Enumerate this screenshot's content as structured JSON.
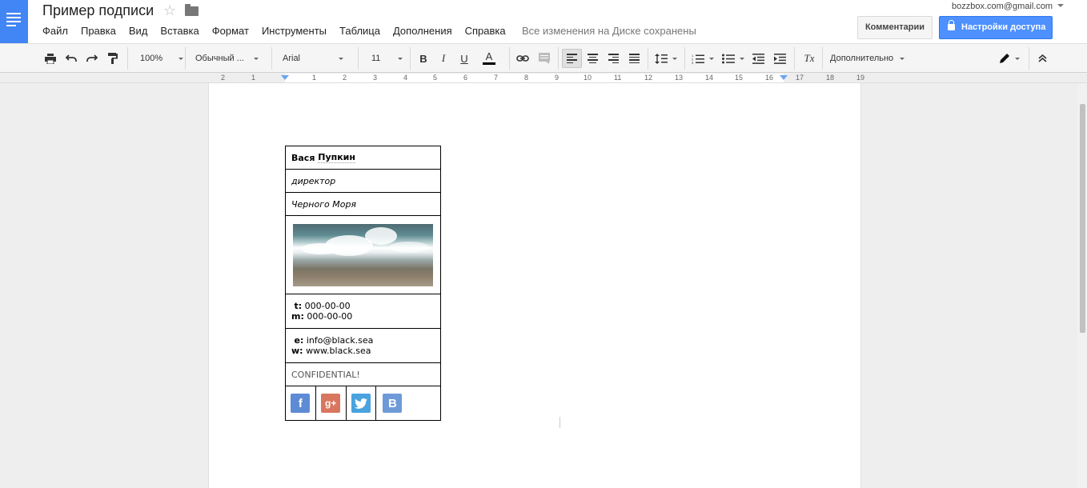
{
  "document": {
    "title": "Пример подписи",
    "save_status": "Все изменения на Диске сохранены"
  },
  "account": {
    "email": "bozzbox.com@gmail.com"
  },
  "buttons": {
    "comments": "Комментарии",
    "share": "Настройки доступа"
  },
  "menu": [
    "Файл",
    "Правка",
    "Вид",
    "Вставка",
    "Формат",
    "Инструменты",
    "Таблица",
    "Дополнения",
    "Справка"
  ],
  "toolbar": {
    "zoom": "100%",
    "style": "Обычный ...",
    "font": "Arial",
    "font_size": "11",
    "bold": "B",
    "italic": "I",
    "underline": "U",
    "text_color": "A",
    "clear_format": "Tx",
    "more": "Дополнительно"
  },
  "ruler": [
    "2",
    "1",
    "1",
    "2",
    "3",
    "4",
    "5",
    "6",
    "7",
    "8",
    "9",
    "10",
    "11",
    "12",
    "13",
    "14",
    "15",
    "16",
    "17",
    "18",
    "19"
  ],
  "signature": {
    "name_first": "Вася",
    "name_last": "Пупкин",
    "title": "директор",
    "place": "Черного Моря",
    "phone_t_label": "t:",
    "phone_t": "000-00-00",
    "phone_m_label": "m:",
    "phone_m": "000-00-00",
    "email_label": "e:",
    "email": "info@black.sea",
    "web_label": "w:",
    "web": "www.black.sea",
    "confidential": "CONFIDENTIAL!",
    "social": [
      {
        "glyph": "f",
        "color": "#5e8bd6"
      },
      {
        "glyph": "g+",
        "color": "#d9765f"
      },
      {
        "glyph": "t",
        "color": "#4aa3df"
      },
      {
        "glyph": "B",
        "color": "#6e9bd8"
      }
    ]
  }
}
